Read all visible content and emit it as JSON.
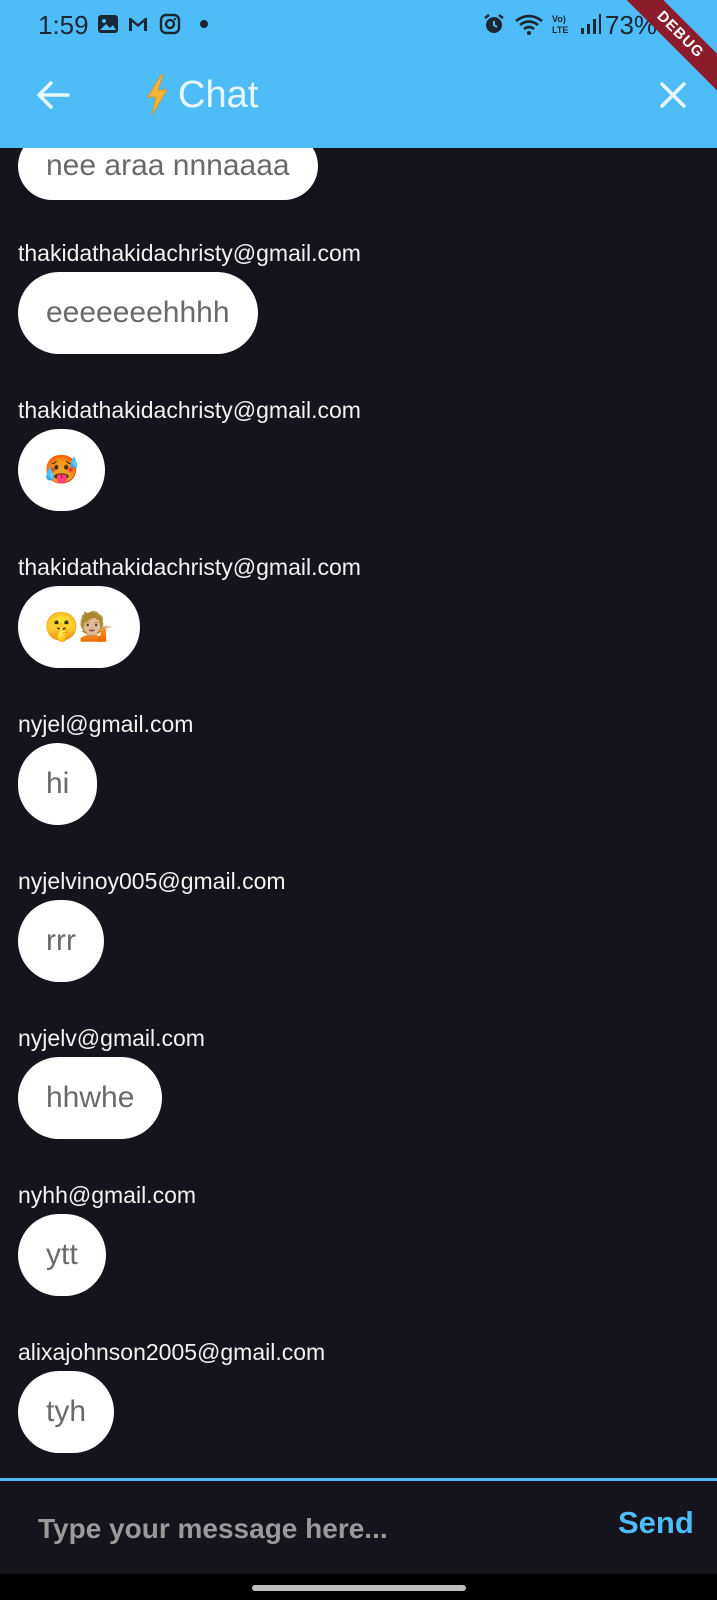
{
  "status_bar": {
    "time": "1:59",
    "battery": "73%"
  },
  "app_bar": {
    "title": "Chat",
    "title_icon": "lightning-bolt-icon",
    "back_icon": "arrow-left-icon",
    "close_icon": "close-icon",
    "debug_banner": "DEBUG"
  },
  "messages": [
    {
      "sender": "",
      "text": "nee araa nnnaaaa"
    },
    {
      "sender": "thakidathakidachristy@gmail.com",
      "text": "eeeeeeehhhh"
    },
    {
      "sender": "thakidathakidachristy@gmail.com",
      "text": "🥵"
    },
    {
      "sender": "thakidathakidachristy@gmail.com",
      "text": "🤫💁🏼"
    },
    {
      "sender": "nyjel@gmail.com",
      "text": "hi"
    },
    {
      "sender": "nyjelvinoy005@gmail.com",
      "text": "rrr"
    },
    {
      "sender": "nyjelv@gmail.com",
      "text": "hhwhe"
    },
    {
      "sender": "nyhh@gmail.com",
      "text": "ytt"
    },
    {
      "sender": "alixajohnson2005@gmail.com",
      "text": "tyh"
    }
  ],
  "composer": {
    "placeholder": "Type your message here...",
    "send_label": "Send"
  },
  "colors": {
    "accent": "#4ebdf7",
    "background": "#15131c",
    "bubble": "#ffffff"
  }
}
